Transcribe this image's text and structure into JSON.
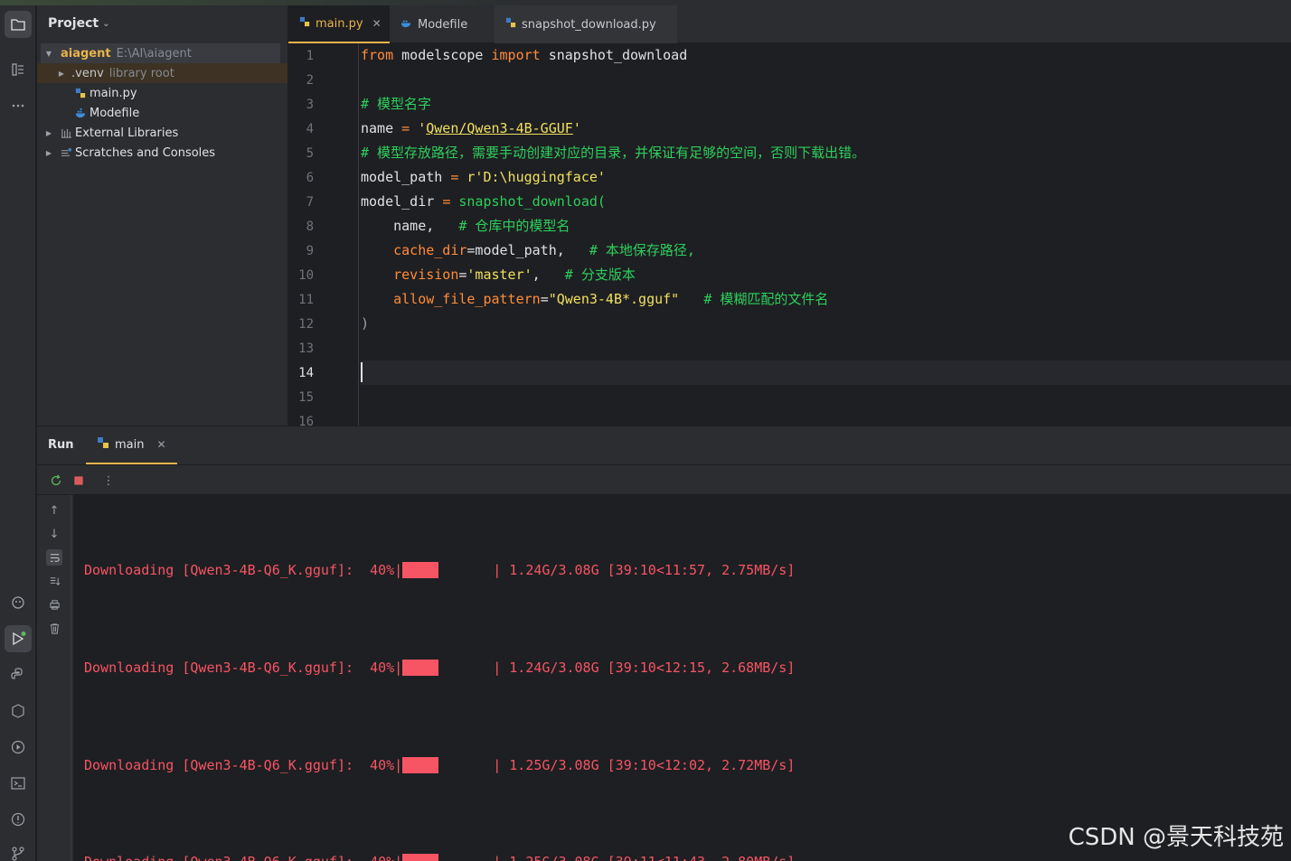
{
  "project_panel": {
    "title": "Project",
    "tree": [
      {
        "name": "aiagent",
        "hint": "E:\\AI\\aiagent"
      },
      {
        "name": ".venv",
        "hint": "library root"
      },
      {
        "name": "main.py"
      },
      {
        "name": "Modefile"
      },
      {
        "name": "External Libraries"
      },
      {
        "name": "Scratches and Consoles"
      }
    ]
  },
  "editor": {
    "tabs": [
      {
        "label": "main.py",
        "active": true
      },
      {
        "label": "Modefile"
      },
      {
        "label": "snapshot_download.py"
      }
    ],
    "line_numbers": [
      "1",
      "2",
      "3",
      "4",
      "5",
      "6",
      "7",
      "8",
      "9",
      "10",
      "11",
      "12",
      "13",
      "14",
      "15",
      "16"
    ],
    "current_line": "14",
    "code": {
      "l1_from": "from",
      "l1_mod": " modelscope ",
      "l1_import": "import",
      "l1_fn": " snapshot_download",
      "l3": "# 模型名字",
      "l4_a": "name ",
      "l4_eq": "=",
      "l4_sp": " ",
      "l4_q1": "'",
      "l4_val": "Qwen/Qwen3-4B-GGUF",
      "l4_q2": "'",
      "l5": "# 模型存放路径，需要手动创建对应的目录，并保证有足够的空间，否则下载出错。",
      "l6_a": "model_path ",
      "l6_eq": "=",
      "l6_val": " r'D:\\huggingface'",
      "l7_a": "model_dir ",
      "l7_eq": "=",
      "l7_fn": " snapshot_download(",
      "l8_a": "    name",
      "l8_b": ",   ",
      "l8_c": "# 仓库中的模型名",
      "l9_a": "    cache_dir",
      "l9_b": "=model_path",
      "l9_c": ",   ",
      "l9_d": "# 本地保存路径,",
      "l10_a": "    revision",
      "l10_b": "=",
      "l10_c": "'master'",
      "l10_d": ",   ",
      "l10_e": "# 分支版本",
      "l11_a": "    allow_file_pattern",
      "l11_b": "=",
      "l11_c": "\"Qwen3-4B*.gguf\"",
      "l11_d": "   ",
      "l11_e": "# 模糊匹配的文件名",
      "l12": ")"
    }
  },
  "run_panel": {
    "title": "Run",
    "tab_label": "main",
    "output": [
      {
        "prefix": "Downloading [Qwen3-4B-Q6_K.gguf]:  40%|",
        "progress": 0.4,
        "suffix": "| 1.24G/3.08G [39:10<11:57, 2.75MB/s]"
      },
      {
        "prefix": "Downloading [Qwen3-4B-Q6_K.gguf]:  40%|",
        "progress": 0.4,
        "suffix": "| 1.24G/3.08G [39:10<12:15, 2.68MB/s]"
      },
      {
        "prefix": "Downloading [Qwen3-4B-Q6_K.gguf]:  40%|",
        "progress": 0.4,
        "suffix": "| 1.25G/3.08G [39:10<12:02, 2.72MB/s]"
      },
      {
        "prefix": "Downloading [Qwen3-4B-Q6_K.gguf]:  40%|",
        "progress": 0.4,
        "suffix": "| 1.25G/3.08G [39:11<11:43, 2.80MB/s]"
      }
    ]
  },
  "watermark": "CSDN @景天科技苑",
  "colors": {
    "accent": "#e8b24a",
    "error_red": "#f75464",
    "comment": "#2ecf5c",
    "keyword": "#ff8c3a",
    "string": "#f0e060"
  }
}
